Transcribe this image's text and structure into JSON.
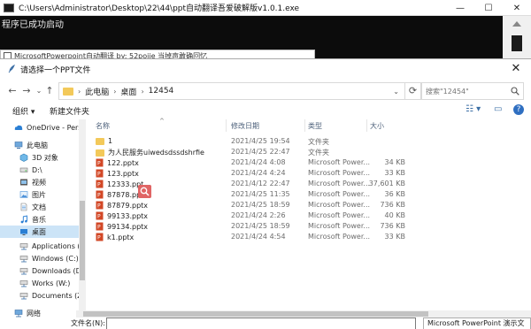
{
  "console": {
    "title": "C:\\Users\\Administrator\\Desktop\\22\\44\\ppt自动翻译吾爱破解版v1.0.1.exe",
    "output": "程序已成功启动",
    "minimize": "—",
    "maximize": "☐",
    "close": "✕"
  },
  "app": {
    "title": "MicrosoftPowerpoint自动翻译    by: 52pojie 当掉声敢确回忆"
  },
  "dialog": {
    "title": "请选择一个PPT文件",
    "close": "✕",
    "nav": {
      "back": "←",
      "forward": "→",
      "dropdown": "⌄",
      "up": "↑"
    },
    "breadcrumb": [
      "此电脑",
      "桌面",
      "12454"
    ],
    "crumb_sep": "›",
    "address_dropdown": "⌄",
    "refresh": "⟳",
    "search_placeholder": "搜索\"12454\"",
    "toolbar": {
      "organize": "组织 ▾",
      "new_folder": "新建文件夹",
      "view_icon": "☷ ▾",
      "pane_icon": "▭",
      "help_icon": "?"
    },
    "nav_pane": [
      {
        "label": "OneDrive - Pers",
        "icon": "cloud"
      },
      {
        "label": "此电脑",
        "icon": "computer"
      },
      {
        "label": "3D 对象",
        "icon": "cube"
      },
      {
        "label": "D:\\",
        "icon": "drive"
      },
      {
        "label": "视频",
        "icon": "video"
      },
      {
        "label": "图片",
        "icon": "picture"
      },
      {
        "label": "文档",
        "icon": "document"
      },
      {
        "label": "音乐",
        "icon": "music"
      },
      {
        "label": "桌面",
        "icon": "desktop",
        "selected": true
      },
      {
        "label": "Applications (A",
        "icon": "drive"
      },
      {
        "label": "Windows (C:)",
        "icon": "drive"
      },
      {
        "label": "Downloads (D:",
        "icon": "drive"
      },
      {
        "label": "Works (W:)",
        "icon": "drive"
      },
      {
        "label": "Documents (Z:)",
        "icon": "drive"
      },
      {
        "label": "网络",
        "icon": "network"
      }
    ],
    "columns": {
      "name": "名称",
      "date": "修改日期",
      "type": "类型",
      "size": "大小",
      "sort_arrow": "^"
    },
    "files": [
      {
        "name": "1",
        "date": "2021/4/25 19:54",
        "type": "文件夹",
        "size": "",
        "kind": "folder"
      },
      {
        "name": "为人民服务uiwedsdssdshrfie",
        "date": "2021/4/25 22:47",
        "type": "文件夹",
        "size": "",
        "kind": "folder"
      },
      {
        "name": "122.pptx",
        "date": "2021/4/24 4:08",
        "type": "Microsoft Power...",
        "size": "34 KB",
        "kind": "pptx"
      },
      {
        "name": "123.pptx",
        "date": "2021/4/24 4:24",
        "type": "Microsoft Power...",
        "size": "33 KB",
        "kind": "pptx"
      },
      {
        "name": "12333.ppt",
        "date": "2021/4/12 22:47",
        "type": "Microsoft Power...",
        "size": "37,601 KB",
        "kind": "pptx"
      },
      {
        "name": "87878.pptx",
        "date": "2021/4/25 11:35",
        "type": "Microsoft Power...",
        "size": "36 KB",
        "kind": "pptx"
      },
      {
        "name": "87879.pptx",
        "date": "2021/4/25 18:59",
        "type": "Microsoft Power...",
        "size": "736 KB",
        "kind": "pptx"
      },
      {
        "name": "99133.pptx",
        "date": "2021/4/24 2:26",
        "type": "Microsoft Power...",
        "size": "40 KB",
        "kind": "pptx"
      },
      {
        "name": "99134.pptx",
        "date": "2021/4/25 18:59",
        "type": "Microsoft Power...",
        "size": "736 KB",
        "kind": "pptx"
      },
      {
        "name": "k1.pptx",
        "date": "2021/4/24 4:54",
        "type": "Microsoft Power...",
        "size": "33 KB",
        "kind": "pptx"
      }
    ],
    "filename_label": "文件名(N):",
    "filetype": "Microsoft PowerPoint 演示文"
  },
  "colors": {
    "ppt_red": "#d24726",
    "folder": "#f3c95a",
    "selection": "#cce4f7"
  }
}
